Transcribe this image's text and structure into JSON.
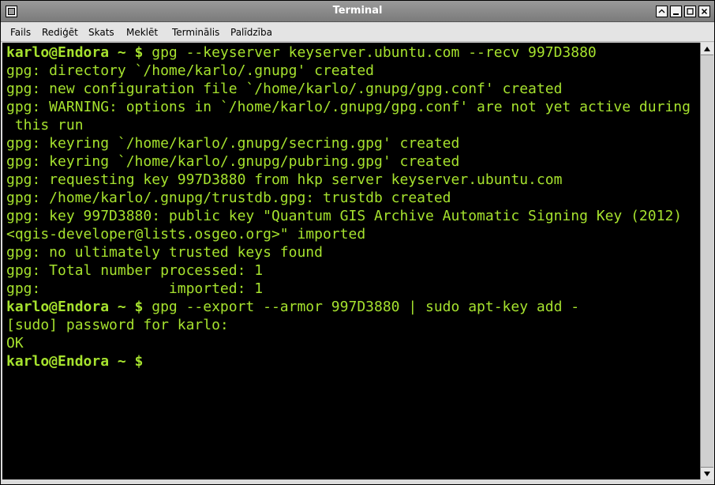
{
  "window": {
    "title": "Terminal"
  },
  "menu": [
    "Fails",
    "Rediģēt",
    "Skats",
    "Meklēt",
    "Terminālis",
    "Palīdzība"
  ],
  "terminal": {
    "lines": [
      {
        "prompt": "karlo@Endora ~ $",
        "text": " gpg --keyserver keyserver.ubuntu.com --recv 997D3880"
      },
      {
        "prompt": "",
        "text": "gpg: directory `/home/karlo/.gnupg' created"
      },
      {
        "prompt": "",
        "text": "gpg: new configuration file `/home/karlo/.gnupg/gpg.conf' created"
      },
      {
        "prompt": "",
        "text": "gpg: WARNING: options in `/home/karlo/.gnupg/gpg.conf' are not yet active during"
      },
      {
        "prompt": "",
        "text": " this run"
      },
      {
        "prompt": "",
        "text": "gpg: keyring `/home/karlo/.gnupg/secring.gpg' created"
      },
      {
        "prompt": "",
        "text": "gpg: keyring `/home/karlo/.gnupg/pubring.gpg' created"
      },
      {
        "prompt": "",
        "text": "gpg: requesting key 997D3880 from hkp server keyserver.ubuntu.com"
      },
      {
        "prompt": "",
        "text": "gpg: /home/karlo/.gnupg/trustdb.gpg: trustdb created"
      },
      {
        "prompt": "",
        "text": "gpg: key 997D3880: public key \"Quantum GIS Archive Automatic Signing Key (2012)"
      },
      {
        "prompt": "",
        "text": "<qgis-developer@lists.osgeo.org>\" imported"
      },
      {
        "prompt": "",
        "text": "gpg: no ultimately trusted keys found"
      },
      {
        "prompt": "",
        "text": "gpg: Total number processed: 1"
      },
      {
        "prompt": "",
        "text": "gpg:               imported: 1"
      },
      {
        "prompt": "karlo@Endora ~ $",
        "text": " gpg --export --armor 997D3880 | sudo apt-key add -"
      },
      {
        "prompt": "",
        "text": "[sudo] password for karlo:"
      },
      {
        "prompt": "",
        "text": "OK"
      },
      {
        "prompt": "karlo@Endora ~ $",
        "text": ""
      }
    ]
  },
  "colors": {
    "terminal_fg": "#a6e22e",
    "terminal_bg": "#000000"
  },
  "icons": {
    "window_menu": "window-menu-icon",
    "shade": "shade-icon",
    "minimize": "minimize-icon",
    "maximize": "maximize-icon",
    "close": "close-icon"
  }
}
